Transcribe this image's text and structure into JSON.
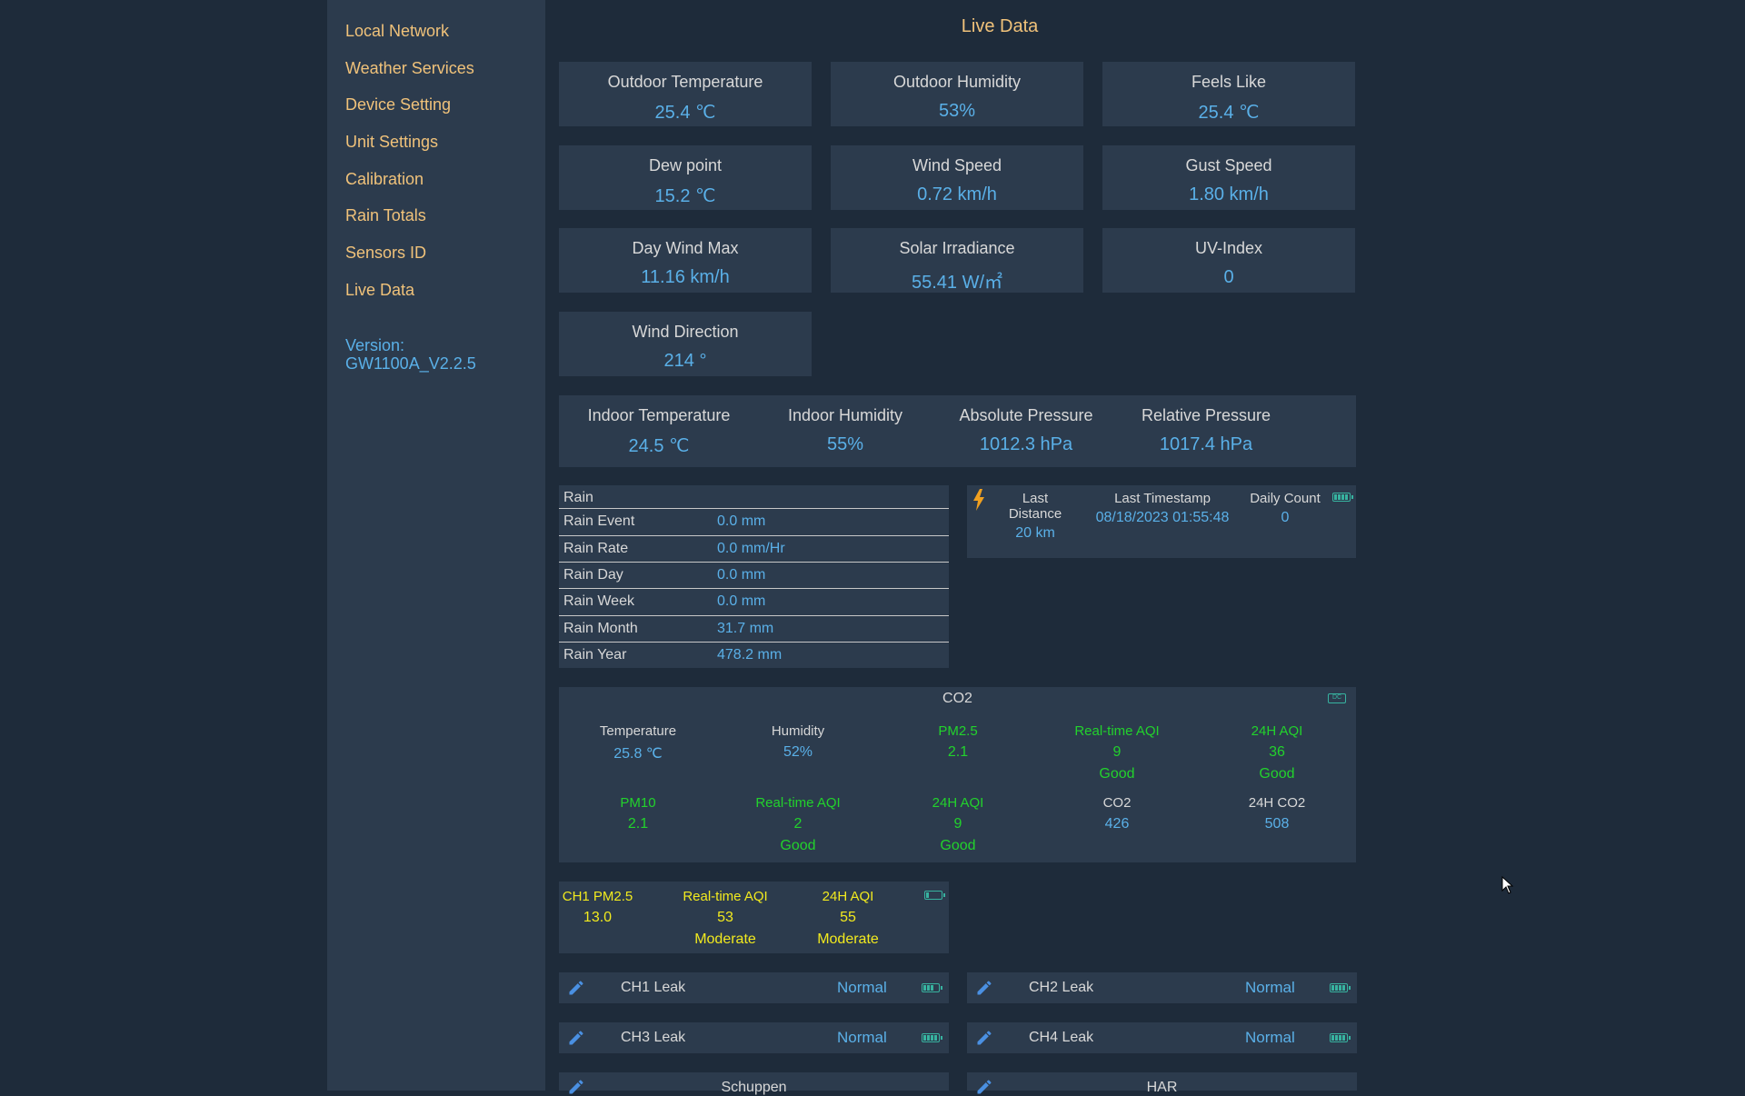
{
  "sidebar": {
    "items": [
      {
        "label": "Local Network"
      },
      {
        "label": "Weather Services"
      },
      {
        "label": "Device Setting"
      },
      {
        "label": "Unit Settings"
      },
      {
        "label": "Calibration"
      },
      {
        "label": "Rain Totals"
      },
      {
        "label": "Sensors ID"
      },
      {
        "label": "Live Data"
      }
    ],
    "version_label": "Version:",
    "version_value": "GW1100A_V2.2.5"
  },
  "page": {
    "title": "Live Data"
  },
  "tiles": [
    {
      "label": "Outdoor Temperature",
      "value": "25.4 ℃"
    },
    {
      "label": "Outdoor Humidity",
      "value": "53%"
    },
    {
      "label": "Feels Like",
      "value": "25.4 ℃"
    },
    {
      "label": "Dew point",
      "value": "15.2 ℃"
    },
    {
      "label": "Wind Speed",
      "value": "0.72 km/h"
    },
    {
      "label": "Gust Speed",
      "value": "1.80 km/h"
    },
    {
      "label": "Day Wind Max",
      "value": "11.16 km/h"
    },
    {
      "label": "Solar Irradiance",
      "value": "55.41 W/㎡"
    },
    {
      "label": "UV-Index",
      "value": "0"
    },
    {
      "label": "Wind Direction",
      "value": "214 °"
    }
  ],
  "indoor": [
    {
      "label": "Indoor Temperature",
      "value": "24.5 ℃"
    },
    {
      "label": "Indoor Humidity",
      "value": "55%"
    },
    {
      "label": "Absolute Pressure",
      "value": "1012.3 hPa"
    },
    {
      "label": "Relative Pressure",
      "value": "1017.4 hPa"
    }
  ],
  "rain": {
    "header": "Rain",
    "rows": [
      {
        "label": "Rain Event",
        "value": "0.0 mm"
      },
      {
        "label": "Rain Rate",
        "value": "0.0 mm/Hr"
      },
      {
        "label": "Rain Day",
        "value": "0.0 mm"
      },
      {
        "label": "Rain Week",
        "value": "0.0 mm"
      },
      {
        "label": "Rain Month",
        "value": "31.7 mm"
      },
      {
        "label": "Rain Year",
        "value": "478.2 mm"
      }
    ]
  },
  "lightning": {
    "last_distance_label": "Last Distance",
    "last_distance": "20 km",
    "last_timestamp_label": "Last Timestamp",
    "last_timestamp": "08/18/2023 01:55:48",
    "daily_count_label": "Daily Count",
    "daily_count": "0",
    "icon": "lightning-icon"
  },
  "co2": {
    "title": "CO2",
    "badge": "DC",
    "row1": [
      {
        "label": "Temperature",
        "value": "25.8 ℃",
        "status": ""
      },
      {
        "label": "Humidity",
        "value": "52%",
        "status": ""
      },
      {
        "label": "PM2.5",
        "value": "2.1",
        "status": ""
      },
      {
        "label": "Real-time AQI",
        "value": "9",
        "status": "Good"
      },
      {
        "label": "24H AQI",
        "value": "36",
        "status": "Good"
      }
    ],
    "row2": [
      {
        "label": "PM10",
        "value": "2.1",
        "status": ""
      },
      {
        "label": "Real-time AQI",
        "value": "2",
        "status": "Good"
      },
      {
        "label": "24H AQI",
        "value": "9",
        "status": "Good"
      },
      {
        "label": "CO2",
        "value": "426",
        "status": ""
      },
      {
        "label": "24H CO2",
        "value": "508",
        "status": ""
      }
    ]
  },
  "pm25": {
    "cols": [
      {
        "label": "CH1 PM2.5",
        "value": "13.0",
        "status": ""
      },
      {
        "label": "Real-time AQI",
        "value": "53",
        "status": "Moderate"
      },
      {
        "label": "24H AQI",
        "value": "55",
        "status": "Moderate"
      }
    ]
  },
  "leaks": [
    {
      "name": "CH1 Leak",
      "status": "Normal"
    },
    {
      "name": "CH2 Leak",
      "status": "Normal"
    },
    {
      "name": "CH3 Leak",
      "status": "Normal"
    },
    {
      "name": "CH4 Leak",
      "status": "Normal"
    }
  ],
  "partial": [
    {
      "name": "Schuppen"
    },
    {
      "name": "HAR"
    }
  ],
  "colors": {
    "background": "#1e2b3a",
    "panel": "#2c3b4d",
    "nav": "#f0c27a",
    "value": "#5ab0e8",
    "good": "#22d22c",
    "moderate": "#f2ea1e",
    "battery": "#37b3a0"
  }
}
